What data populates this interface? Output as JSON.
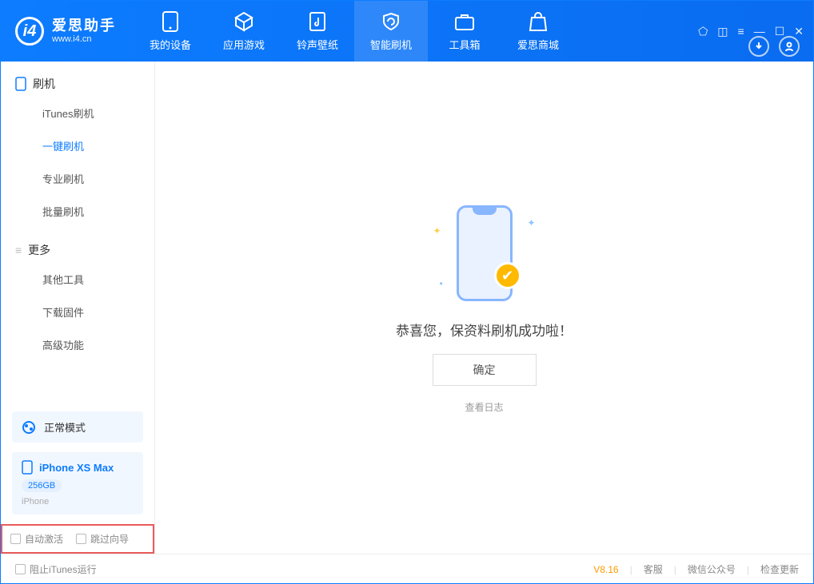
{
  "app": {
    "name_cn": "爱思助手",
    "name_en": "www.i4.cn"
  },
  "tabs": [
    {
      "label": "我的设备"
    },
    {
      "label": "应用游戏"
    },
    {
      "label": "铃声壁纸"
    },
    {
      "label": "智能刷机"
    },
    {
      "label": "工具箱"
    },
    {
      "label": "爱思商城"
    }
  ],
  "sidebar": {
    "section1_label": "刷机",
    "items1": [
      {
        "label": "iTunes刷机"
      },
      {
        "label": "一键刷机"
      },
      {
        "label": "专业刷机"
      },
      {
        "label": "批量刷机"
      }
    ],
    "section2_label": "更多",
    "items2": [
      {
        "label": "其他工具"
      },
      {
        "label": "下载固件"
      },
      {
        "label": "高级功能"
      }
    ]
  },
  "device": {
    "mode_label": "正常模式",
    "name": "iPhone XS Max",
    "storage": "256GB",
    "type": "iPhone"
  },
  "checkboxes": {
    "auto_activate": "自动激活",
    "skip_guide": "跳过向导"
  },
  "main": {
    "success_message": "恭喜您，保资料刷机成功啦！",
    "ok_button": "确定",
    "view_log": "查看日志"
  },
  "footer": {
    "block_itunes": "阻止iTunes运行",
    "version": "V8.16",
    "service": "客服",
    "wechat": "微信公众号",
    "check_update": "检查更新"
  }
}
